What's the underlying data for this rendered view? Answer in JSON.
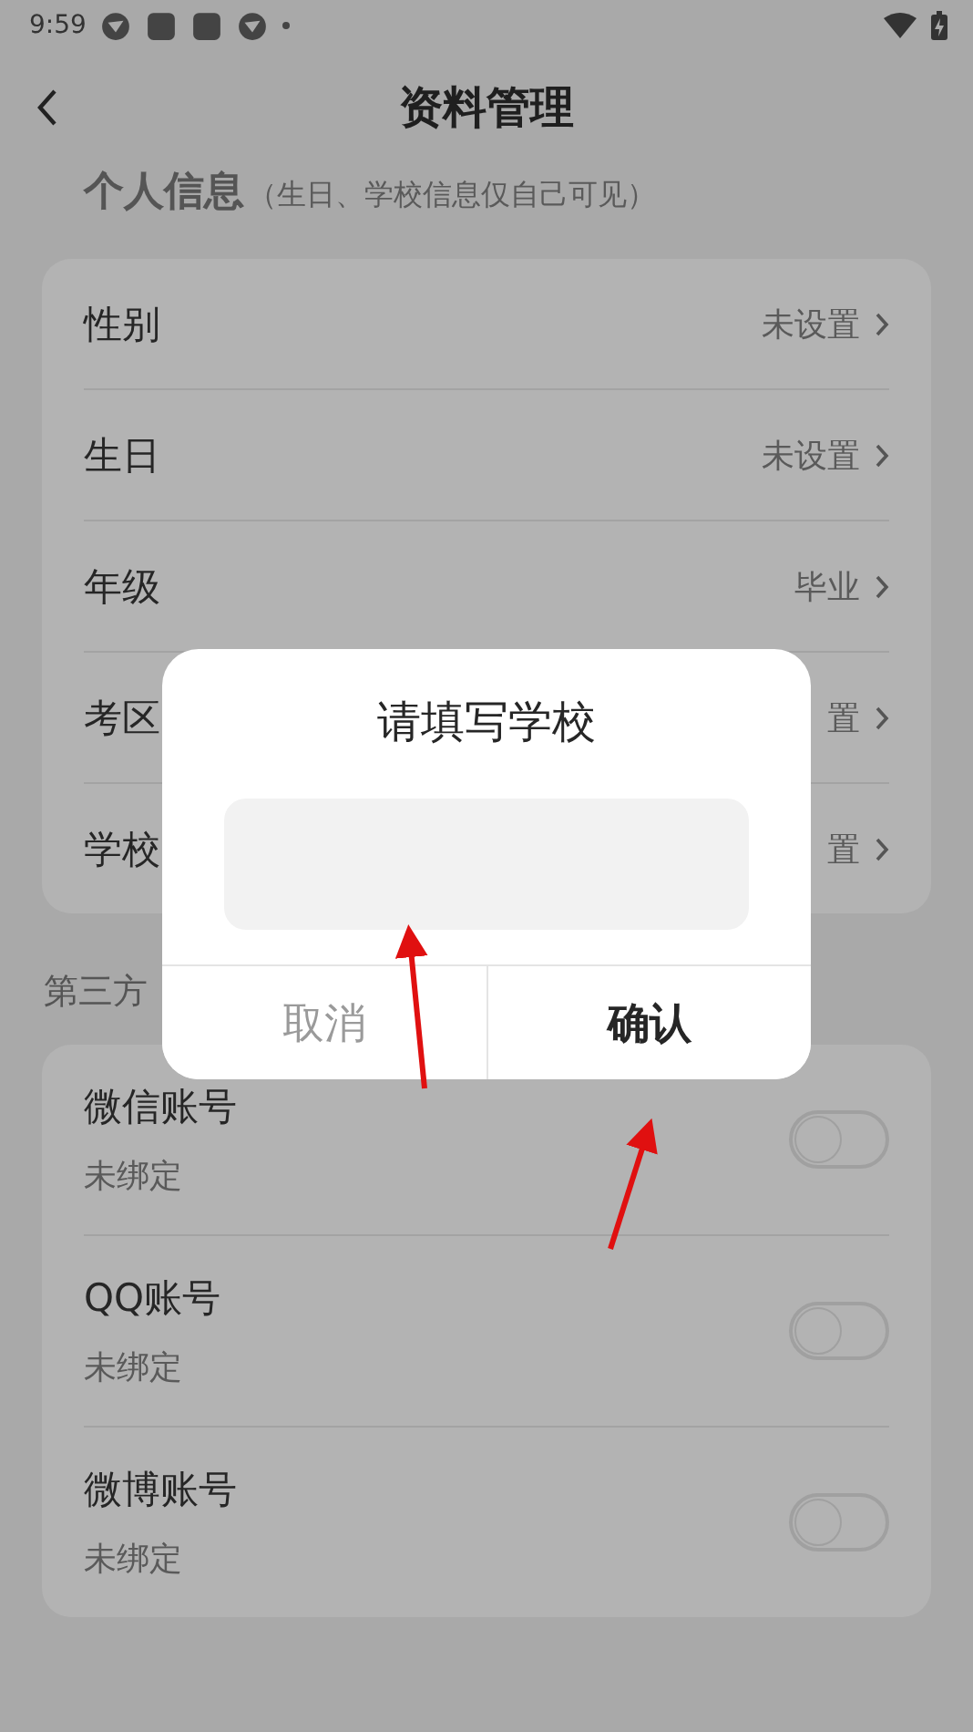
{
  "status_bar": {
    "time": "9:59"
  },
  "header": {
    "title": "资料管理"
  },
  "personal": {
    "title": "个人信息",
    "note": "（生日、学校信息仅自己可见）",
    "rows": [
      {
        "label": "性别",
        "value": "未设置"
      },
      {
        "label": "生日",
        "value": "未设置"
      },
      {
        "label": "年级",
        "value": "毕业"
      },
      {
        "label": "考区",
        "value": "置"
      },
      {
        "label": "学校",
        "value": "置"
      }
    ]
  },
  "third_party": {
    "title": "第三方",
    "accounts": [
      {
        "name": "微信账号",
        "status": "未绑定",
        "on": false
      },
      {
        "name": "QQ账号",
        "status": "未绑定",
        "on": false
      },
      {
        "name": "微博账号",
        "status": "未绑定",
        "on": false
      }
    ]
  },
  "dialog": {
    "title": "请填写学校",
    "buttons": [
      {
        "label": "取消",
        "kind": "cancel"
      },
      {
        "label": "确认",
        "kind": "confirm"
      }
    ]
  }
}
